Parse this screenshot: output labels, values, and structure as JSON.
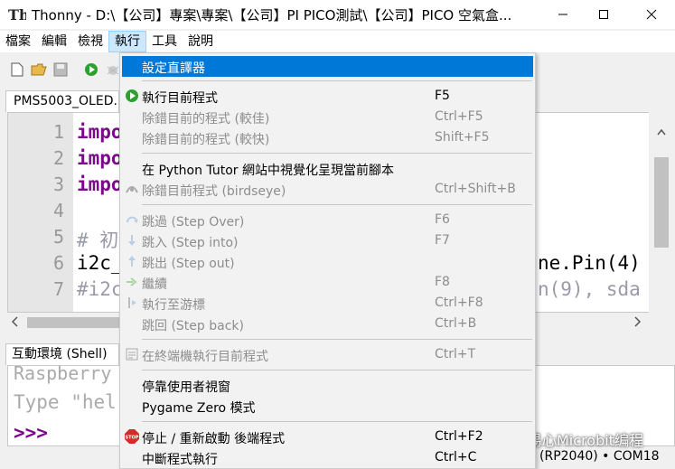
{
  "window": {
    "title": "Thonny  -  D:\\【公司】專案\\專案\\【公司】PI PICO測試\\【公司】PICO 空氣盒...",
    "min_glyph": "—",
    "max_glyph": "☐",
    "close_glyph": "✕"
  },
  "menubar": {
    "items": [
      {
        "label": "檔案"
      },
      {
        "label": "編輯"
      },
      {
        "label": "檢視"
      },
      {
        "label": "執行",
        "active": true
      },
      {
        "label": "工具"
      },
      {
        "label": "說明"
      }
    ]
  },
  "toolbar": {
    "icons": [
      "new-file-icon",
      "open-folder-icon",
      "save-icon",
      "run-icon",
      "debug-icon"
    ]
  },
  "editor": {
    "tab_label": "PMS5003_OLED.",
    "lines": [
      {
        "num": "1",
        "text": "impo"
      },
      {
        "num": "2",
        "text": "impo"
      },
      {
        "num": "3",
        "text": "impo"
      },
      {
        "num": "4",
        "text": ""
      },
      {
        "num": "5",
        "text": "# 初"
      },
      {
        "num": "6",
        "text": "i2c_",
        "right": "ne.Pin(4)"
      },
      {
        "num": "7",
        "text": "#i2c",
        "right": "n(9), sda"
      }
    ]
  },
  "shell": {
    "tab_label": "互動環境 (Shell)",
    "line1": "Raspberry",
    "line2": "Type \"hel",
    "prompt": ">>>"
  },
  "status": {
    "text": "(RP2040)  •  COM18"
  },
  "watermark": {
    "text": "易心Microbit编程"
  },
  "run_menu": {
    "items": [
      {
        "label": "設定直譯器",
        "shortcut": "",
        "icon": "",
        "disabled": false,
        "highlighted": true
      },
      {
        "sep": true
      },
      {
        "label": "執行目前程式",
        "shortcut": "F5",
        "icon": "run-icon",
        "disabled": false
      },
      {
        "label": "除錯目前的程式 (較佳)",
        "shortcut": "Ctrl+F5",
        "icon": "",
        "disabled": true
      },
      {
        "label": "除錯目前的程式 (較快)",
        "shortcut": "Shift+F5",
        "icon": "",
        "disabled": true
      },
      {
        "sep": true
      },
      {
        "label": "在 Python Tutor 網站中視覺化呈現當前腳本",
        "shortcut": "",
        "icon": "",
        "disabled": false
      },
      {
        "label": "除錯目前程式 (birdseye)",
        "shortcut": "Ctrl+Shift+B",
        "icon": "birdseye-icon",
        "disabled": true
      },
      {
        "sep": true
      },
      {
        "label": "跳過 (Step Over)",
        "shortcut": "F6",
        "icon": "step-over-icon",
        "disabled": true
      },
      {
        "label": "跳入 (Step into)",
        "shortcut": "F7",
        "icon": "step-into-icon",
        "disabled": true
      },
      {
        "label": "跳出 (Step out)",
        "shortcut": "",
        "icon": "step-out-icon",
        "disabled": true
      },
      {
        "label": "繼續",
        "shortcut": "F8",
        "icon": "resume-icon",
        "disabled": true
      },
      {
        "label": "執行至游標",
        "shortcut": "Ctrl+F8",
        "icon": "run-to-cursor-icon",
        "disabled": true
      },
      {
        "label": "跳回 (Step back)",
        "shortcut": "Ctrl+B",
        "icon": "",
        "disabled": true
      },
      {
        "sep": true
      },
      {
        "label": "在終端機執行目前程式",
        "shortcut": "Ctrl+T",
        "icon": "terminal-icon",
        "disabled": true
      },
      {
        "sep": true
      },
      {
        "label": "停靠使用者視窗",
        "shortcut": "",
        "icon": "",
        "disabled": false
      },
      {
        "label": "Pygame Zero 模式",
        "shortcut": "",
        "icon": "",
        "disabled": false
      },
      {
        "sep": true
      },
      {
        "label": "停止 / 重新啟動 後端程式",
        "shortcut": "Ctrl+F2",
        "icon": "stop-icon",
        "disabled": false
      },
      {
        "label": "中斷程式執行",
        "shortcut": "Ctrl+C",
        "icon": "",
        "disabled": false
      }
    ]
  },
  "colors": {
    "highlight": "#0078d7",
    "keyword": "#7a0a8a",
    "run_green": "#2ea02e",
    "stop_red": "#d42a2a"
  }
}
